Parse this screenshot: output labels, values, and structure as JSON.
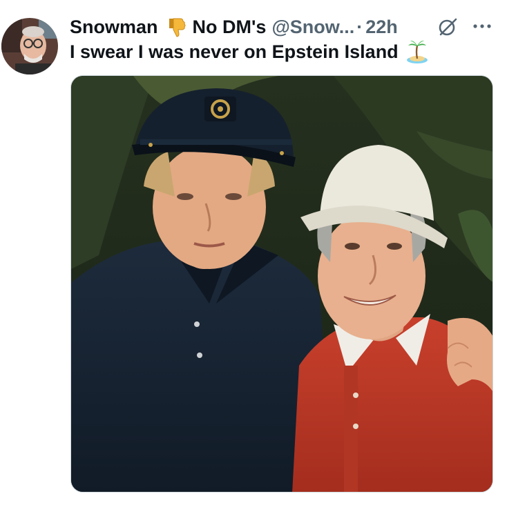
{
  "tweet": {
    "display_name": "Snowman",
    "name_suffix": "No DM's",
    "handle": "@Snow...",
    "separator": "·",
    "time": "22h",
    "text": "I swear I was never on Epstein Island",
    "name_emoji_icon": "thumbs-down-icon",
    "text_emoji_icon": "desert-island-icon",
    "media_description_icon": "photo",
    "colors": {
      "text": "#0f1419",
      "secondary": "#536471",
      "background": "#ffffff"
    }
  }
}
